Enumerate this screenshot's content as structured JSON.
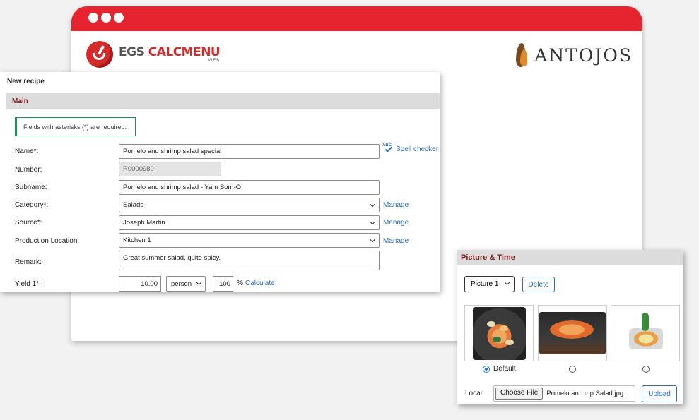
{
  "brand": {
    "left_logo_main": "EGS ",
    "left_logo_accent": "CALCMENU",
    "left_logo_sub": "WEB",
    "right_logo": "ANTOJOS"
  },
  "recipe": {
    "title": "New recipe",
    "section": "Main",
    "notice": "Fields with asterisks (*) are required.",
    "spell_checker": "Spell checker",
    "spell_icon_text": "ABC",
    "fields": {
      "name": {
        "label": "Name*:",
        "value": "Pomelo and shrimp salad special"
      },
      "number": {
        "label": "Number:",
        "value": "R0000980"
      },
      "subname": {
        "label": "Subname:",
        "value": "Pomelo and shrimp salad - Yam Som-O"
      },
      "category": {
        "label": "Category*:",
        "value": "Salads",
        "link": "Manage"
      },
      "source": {
        "label": "Source*:",
        "value": "Joseph Martin",
        "link": "Manage"
      },
      "production_location": {
        "label": "Production Location:",
        "value": "Kitchen 1",
        "link": "Manage"
      },
      "remark": {
        "label": "Remark:",
        "value": "Great summer salad, quite spicy."
      },
      "yield": {
        "label": "Yield 1*:",
        "value": "10.00",
        "unit": "person",
        "percent": "100",
        "percent_sign": "%",
        "calculate": "Calculate"
      }
    }
  },
  "picture": {
    "title": "Picture & Time",
    "selected_picture": "Picture 1",
    "delete_label": "Delete",
    "default_label": "Default",
    "local_label": "Local:",
    "choose_file_label": "Choose File",
    "file_name": "Pomelo an...mp Salad.jpg",
    "upload_label": "Upload",
    "selected_index": 0
  }
}
